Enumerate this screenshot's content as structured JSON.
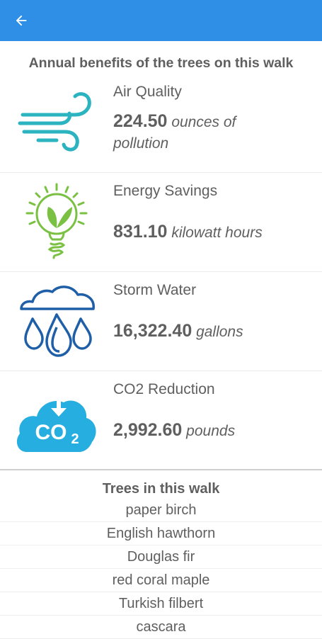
{
  "header": {
    "title": "Annual benefits of the trees on this walk"
  },
  "benefits": [
    {
      "label": "Air Quality",
      "value": "224.50",
      "unit": "ounces of pollution",
      "icon": "wind-icon"
    },
    {
      "label": "Energy Savings",
      "value": "831.10",
      "unit": "kilowatt hours",
      "icon": "lightbulb-leaf-icon"
    },
    {
      "label": "Storm Water",
      "value": "16,322.40",
      "unit": "gallons",
      "icon": "cloud-rain-icon"
    },
    {
      "label": "CO2 Reduction",
      "value": "2,992.60",
      "unit": "pounds",
      "icon": "co2-cloud-icon",
      "icon_text": "CO2"
    }
  ],
  "trees": {
    "title": "Trees in this walk",
    "items": [
      "paper birch",
      "English hawthorn",
      "Douglas fir",
      "red coral maple",
      "Turkish filbert",
      "cascara"
    ]
  },
  "colors": {
    "appbar": "#2f8ee6",
    "wind": "#2bb3c0",
    "leaf": "#7ac143",
    "water": "#1f5fa8",
    "co2": "#27aee0"
  }
}
